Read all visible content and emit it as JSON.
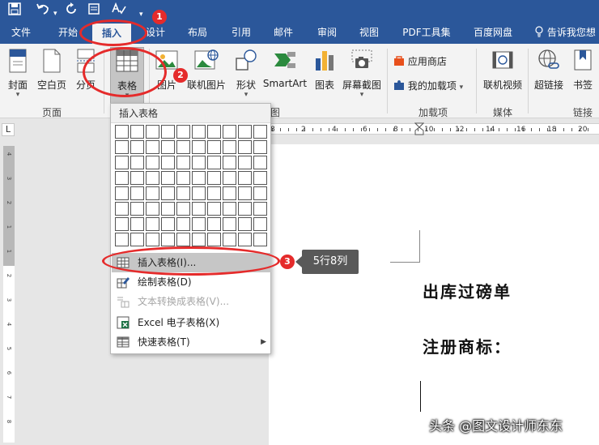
{
  "tabs": {
    "file": "文件",
    "home": "开始",
    "insert": "插入",
    "design": "设计",
    "layout": "布局",
    "references": "引用",
    "mailings": "邮件",
    "review": "审阅",
    "view": "视图",
    "pdf": "PDF工具集",
    "baidu": "百度网盘",
    "tell_me": "告诉我您想"
  },
  "ribbon": {
    "cover": "封面",
    "blank_page": "空白页",
    "page_break": "分页",
    "table": "表格",
    "picture": "图片",
    "online_picture": "联机图片",
    "shapes": "形状",
    "smartart": "SmartArt",
    "chart": "图表",
    "screenshot": "屏幕截图",
    "app_store": "应用商店",
    "my_addins": "我的加载项",
    "online_video": "联机视频",
    "hyperlink": "超链接",
    "bookmark": "书签",
    "group_pages": "页面",
    "group_illustrations": "图",
    "group_addins": "加载项",
    "group_media": "媒体",
    "group_links": "链接",
    "dropdown_mark": "▾"
  },
  "table_menu": {
    "header": "插入表格",
    "grid_rows": 8,
    "grid_cols": 10,
    "items": [
      {
        "label": "插入表格(I)...",
        "highlighted": true,
        "enabled": true
      },
      {
        "label": "绘制表格(D)",
        "enabled": true
      },
      {
        "label": "文本转换成表格(V)...",
        "enabled": false
      },
      {
        "label": "Excel 电子表格(X)",
        "enabled": true
      },
      {
        "label": "快速表格(T)",
        "enabled": true,
        "submenu": true
      }
    ]
  },
  "annotations": {
    "badge_1": "1",
    "badge_2": "2",
    "badge_3": "3",
    "tooltip": "5行8列",
    "color": "#e52b2b"
  },
  "document": {
    "title": "出库过磅单",
    "line2": "注册商标："
  },
  "ruler": {
    "h_labels": [
      "8",
      "2",
      "4",
      "6",
      "8",
      "10",
      "12",
      "14",
      "16",
      "18",
      "20"
    ],
    "v_labels": [
      "4",
      "3",
      "2",
      "1",
      "1",
      "2",
      "3",
      "4",
      "5",
      "6",
      "7",
      "8"
    ],
    "tab_stop": "L"
  },
  "watermark": "头条 @图文设计师东东",
  "colors": {
    "ribbon_blue": "#2b579a",
    "ribbon_bg": "#f3f3f3",
    "highlight": "#c6c6c6"
  }
}
